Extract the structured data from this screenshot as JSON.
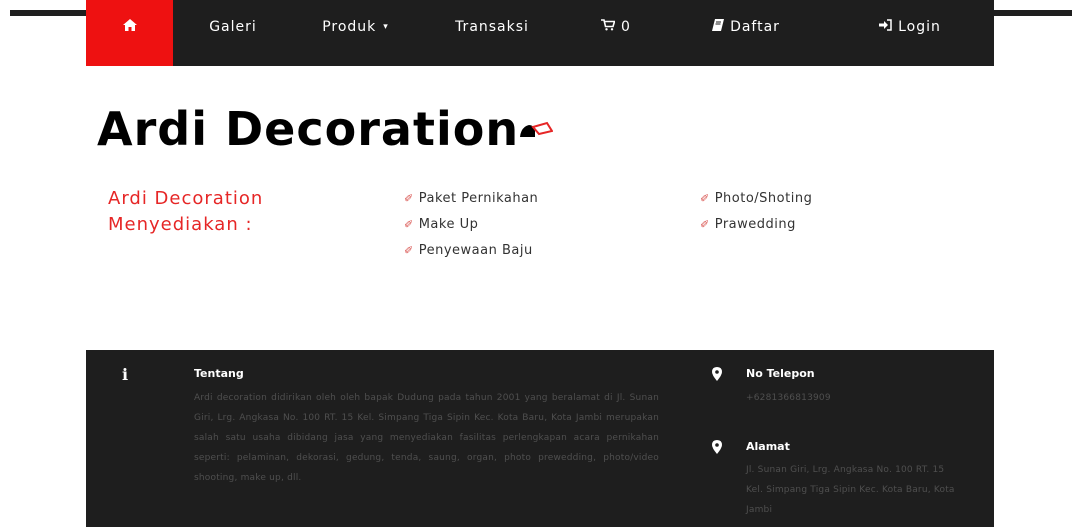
{
  "navbar": {
    "home_icon": "home-icon",
    "items": [
      {
        "label": "Galeri"
      },
      {
        "label": "Produk",
        "caret": "▾"
      },
      {
        "label": "Transaksi"
      },
      {
        "label": "0",
        "icon": "cart-icon"
      },
      {
        "label": "Daftar",
        "icon": "book-icon"
      },
      {
        "label": "Login",
        "icon": "sign-in-icon"
      }
    ]
  },
  "hero": {
    "title": "Ardi Decoration"
  },
  "services": {
    "heading_line1": "Ardi Decoration",
    "heading_line2": "Menyediakan :",
    "column1": [
      "Paket Pernikahan",
      "Make Up",
      "Penyewaan Baju"
    ],
    "column2": [
      "Photo/Shoting",
      "Prawedding"
    ]
  },
  "footer": {
    "about_title": "Tentang",
    "about_text": "Ardi decoration didirikan oleh oleh bapak Dudung pada tahun 2001 yang beralamat di Jl. Sunan Giri, Lrg. Angkasa No. 100 RT. 15 Kel. Simpang Tiga Sipin Kec. Kota Baru, Kota Jambi merupakan salah satu usaha dibidang jasa yang menyediakan fasilitas perlengkapan acara pernikahan seperti: pelaminan, dekorasi, gedung, tenda, saung, organ, photo prewedding, photo/video shooting, make up, dll.",
    "phone_title": "No Telepon",
    "phone": "+6281366813909",
    "address_title": "Alamat",
    "address": "Jl. Sunan Giri, Lrg. Angkasa No. 100 RT. 15 Kel. Simpang Tiga Sipin Kec. Kota Baru, Kota Jambi"
  },
  "colors": {
    "nav_bg": "#1e1e1e",
    "home_active": "#ee1111",
    "accent_red": "#e62626",
    "footer_text": "#4f4f4f"
  }
}
